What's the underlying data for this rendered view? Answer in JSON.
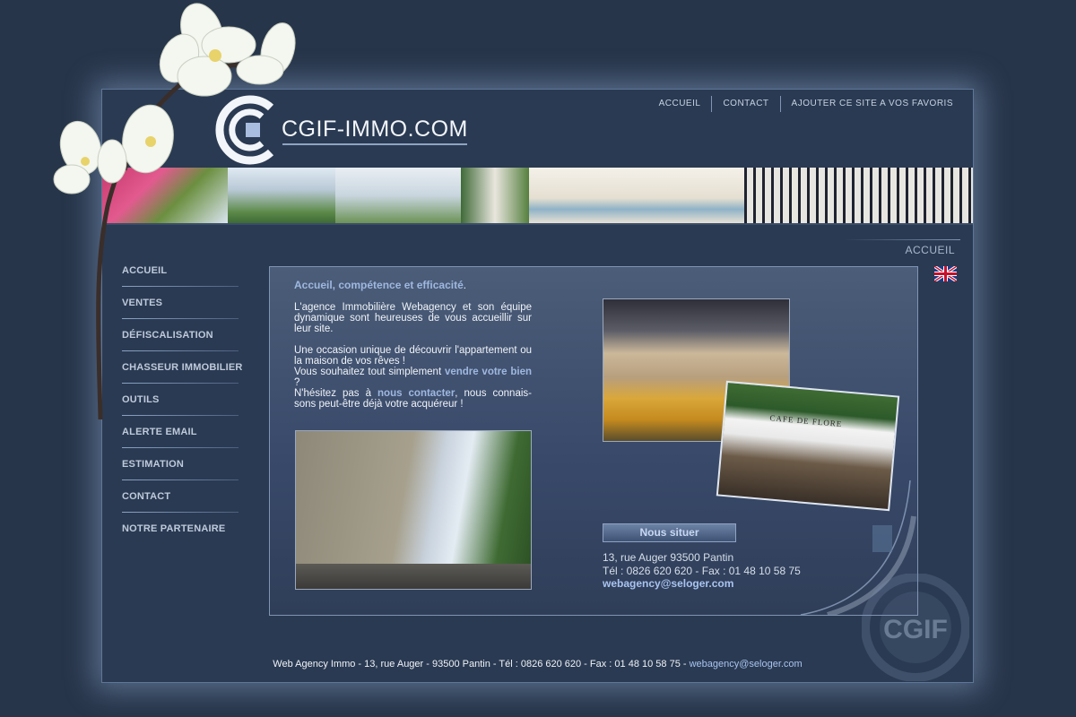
{
  "site": {
    "logo_text": "CGIF-IMMO.COM",
    "watermark": "CGIF"
  },
  "topnav": [
    "ACCUEIL",
    "CONTACT",
    "AJOUTER CE SITE A VOS FAVORIS"
  ],
  "breadcrumb": "ACCUEIL",
  "menu": [
    "ACCUEIL",
    "VENTES",
    "DÉFISCALISATION",
    "CHASSEUR IMMOBILIER",
    "OUTILS",
    "ALERTE EMAIL",
    "ESTIMATION",
    "CONTACT",
    "NOTRE PARTENAIRE"
  ],
  "intro": {
    "title": "Accueil, compétence et efficacité",
    "title_end": ".",
    "p1": "L'agence Immobilière Webagency et son équipe dynamique sont heureuses de vous accueillir sur leur site.",
    "p2a": "Une occasion unique de découvrir l'appartement ou la maison de vos rêves !",
    "p2b_pre": "Vous souhaitez tout simplement ",
    "p2b_link": "vendre votre bien",
    "p2b_post": " ?",
    "p2c_pre": "N'hésitez pas à ",
    "p2c_link": "nous contacter",
    "p2c_post": ", nous connais-sons peut-être déjà votre acquéreur !"
  },
  "locate": {
    "button": "Nous situer",
    "address": "13, rue Auger 93500 Pantin",
    "phone": "Tél : 0826 620 620 - Fax : 01 48 10 58 75",
    "email": "webagency@seloger.com"
  },
  "cafe_sign": "CAFE DE FLORE",
  "footer": {
    "text": "Web Agency Immo - 13, rue Auger - 93500 Pantin - Tél : 0826 620 620 - Fax : 01 48 10 58 75 - ",
    "email": "webagency@seloger.com"
  },
  "colors": {
    "background": "#27354a",
    "accent": "#9fb8e0",
    "link": "#a9c4f0"
  }
}
